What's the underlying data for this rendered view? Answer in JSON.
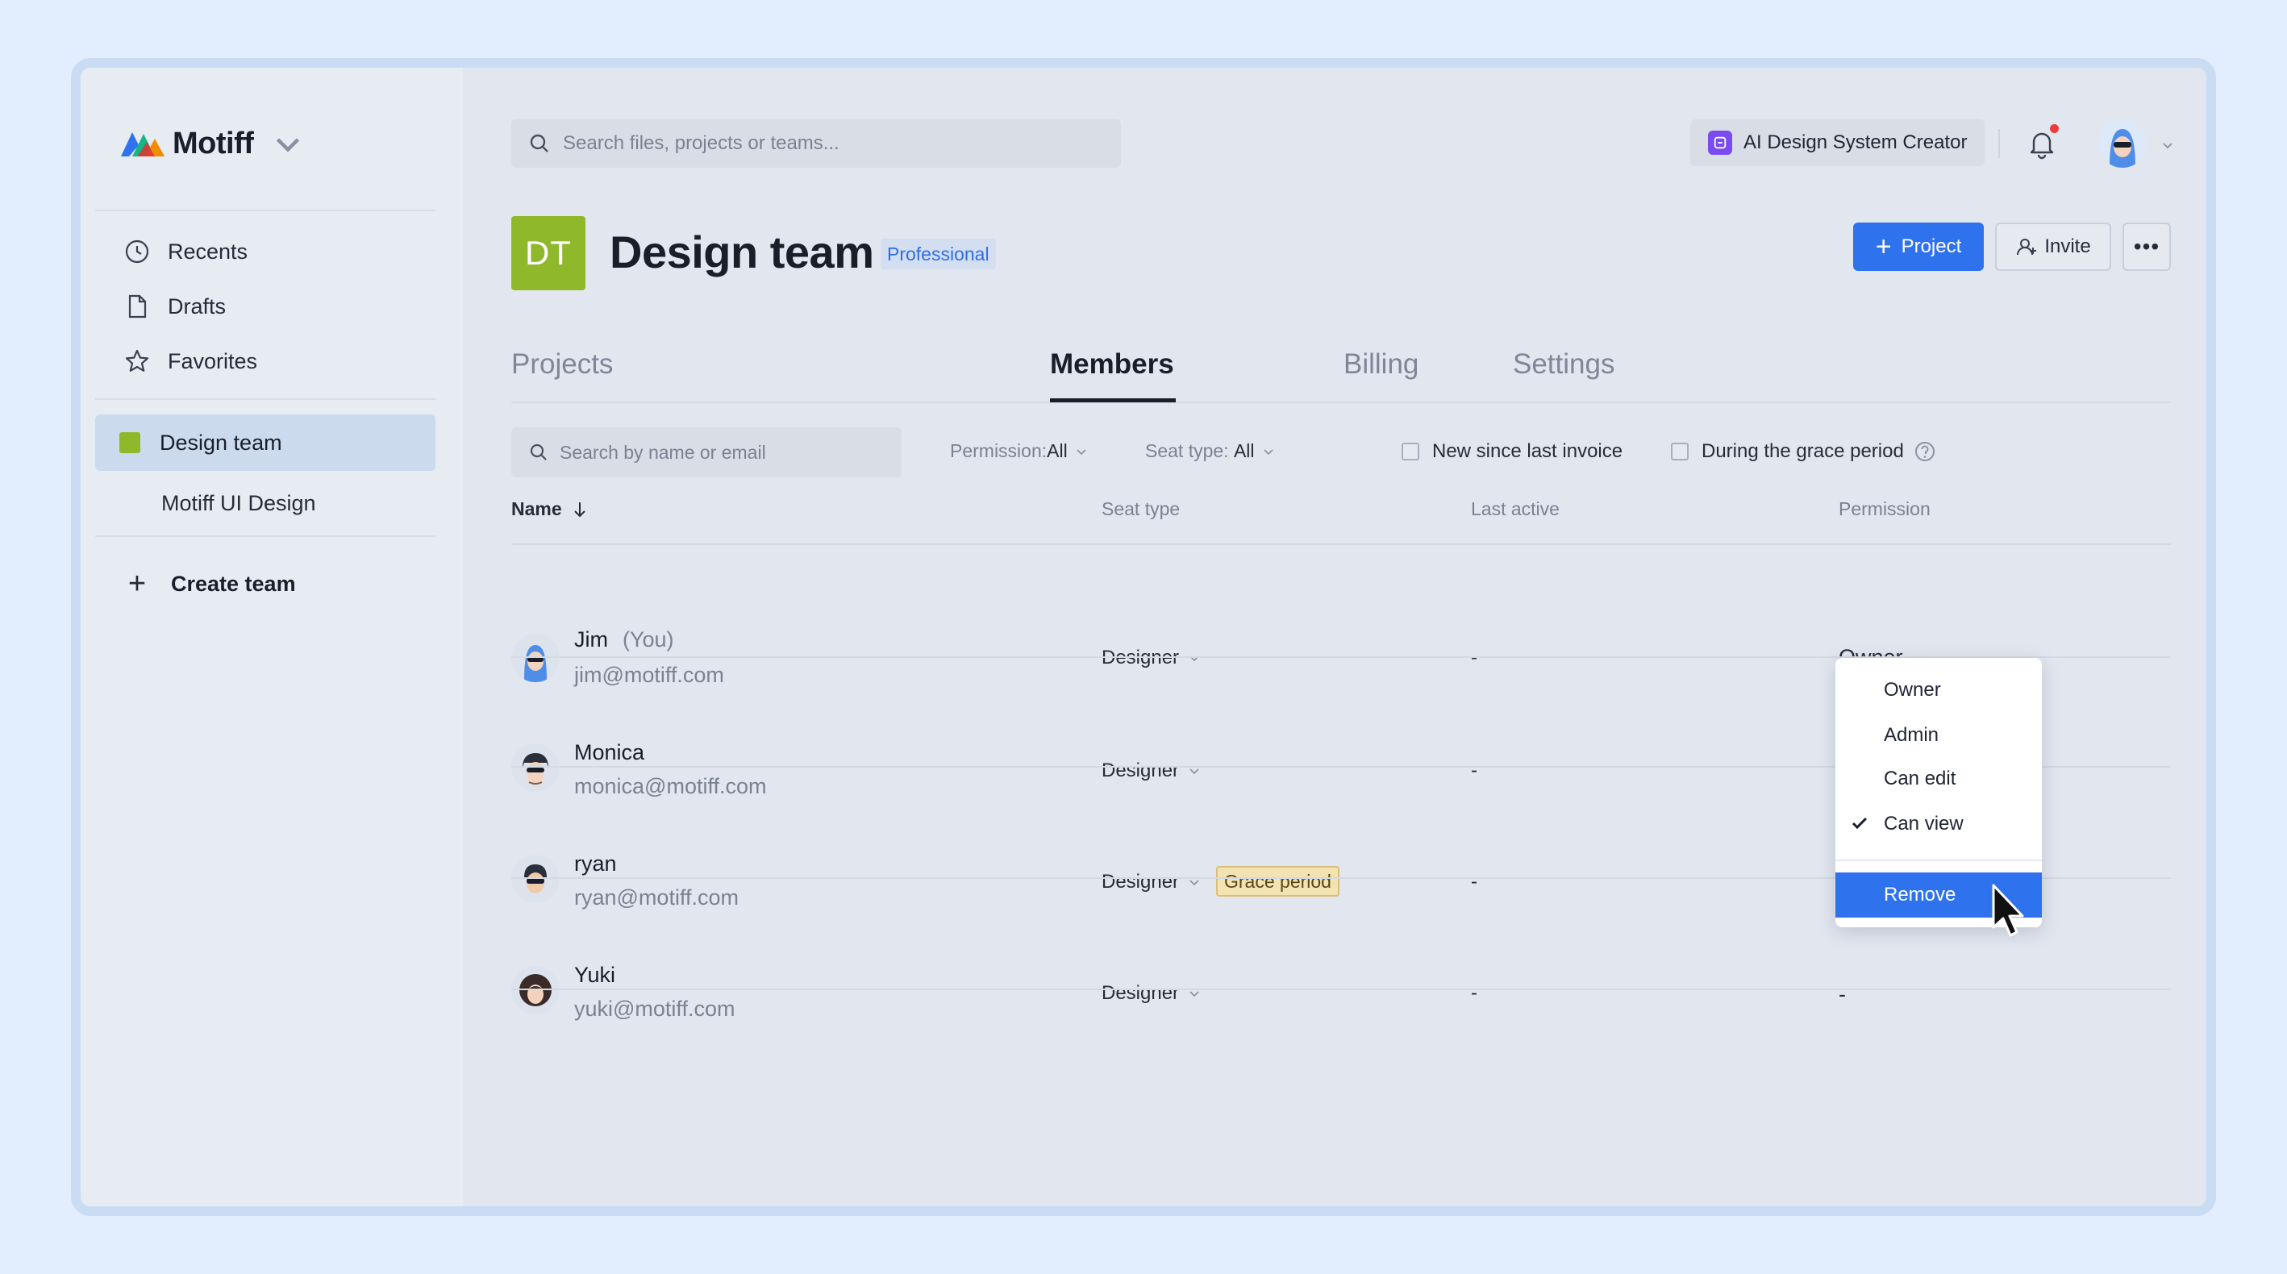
{
  "app": {
    "name": "Motiff"
  },
  "sidebar": {
    "nav": [
      {
        "label": "Recents",
        "icon": "clock-icon"
      },
      {
        "label": "Drafts",
        "icon": "file-icon"
      },
      {
        "label": "Favorites",
        "icon": "star-icon"
      }
    ],
    "team": "Design team",
    "sub_team": "Motiff UI Design",
    "create_team": "Create team"
  },
  "topbar": {
    "search_placeholder": "Search files, projects or teams...",
    "ai_button": "AI Design System Creator"
  },
  "team_header": {
    "initials": "DT",
    "title": "Design team",
    "plan": "Professional",
    "project_button": "Project",
    "invite_button": "Invite"
  },
  "tabs": [
    "Projects",
    "Members",
    "Billing",
    "Settings"
  ],
  "active_tab": "Members",
  "filters": {
    "search_placeholder": "Search by name or email",
    "permission_label": "Permission:",
    "permission_value": "All",
    "seat_label": "Seat type: ",
    "seat_value": "All",
    "new_since": "New since last invoice",
    "grace": "During the grace period"
  },
  "table": {
    "headers": {
      "name": "Name",
      "seat": "Seat type",
      "last": "Last active",
      "permission": "Permission"
    },
    "rows": [
      {
        "name": "Jim",
        "tag": "(You)",
        "email": "jim@motiff.com",
        "seat": "Designer",
        "last": "-",
        "permission": "Owner"
      },
      {
        "name": "Monica",
        "email": "monica@motiff.com",
        "seat": "Designer",
        "last": "-"
      },
      {
        "name": "ryan",
        "email": "ryan@motiff.com",
        "seat": "Designer",
        "badge": "Grace period",
        "last": "-"
      },
      {
        "name": "Yuki",
        "email": "yuki@motiff.com",
        "seat": "Designer",
        "last": "-",
        "permission": "-"
      }
    ]
  },
  "permission_menu": {
    "items": [
      "Owner",
      "Admin",
      "Can edit",
      "Can view"
    ],
    "checked": "Can view",
    "remove": "Remove"
  },
  "colors": {
    "accent": "#2f72ee",
    "team": "#8fb82a",
    "background": "#e2eefd"
  }
}
